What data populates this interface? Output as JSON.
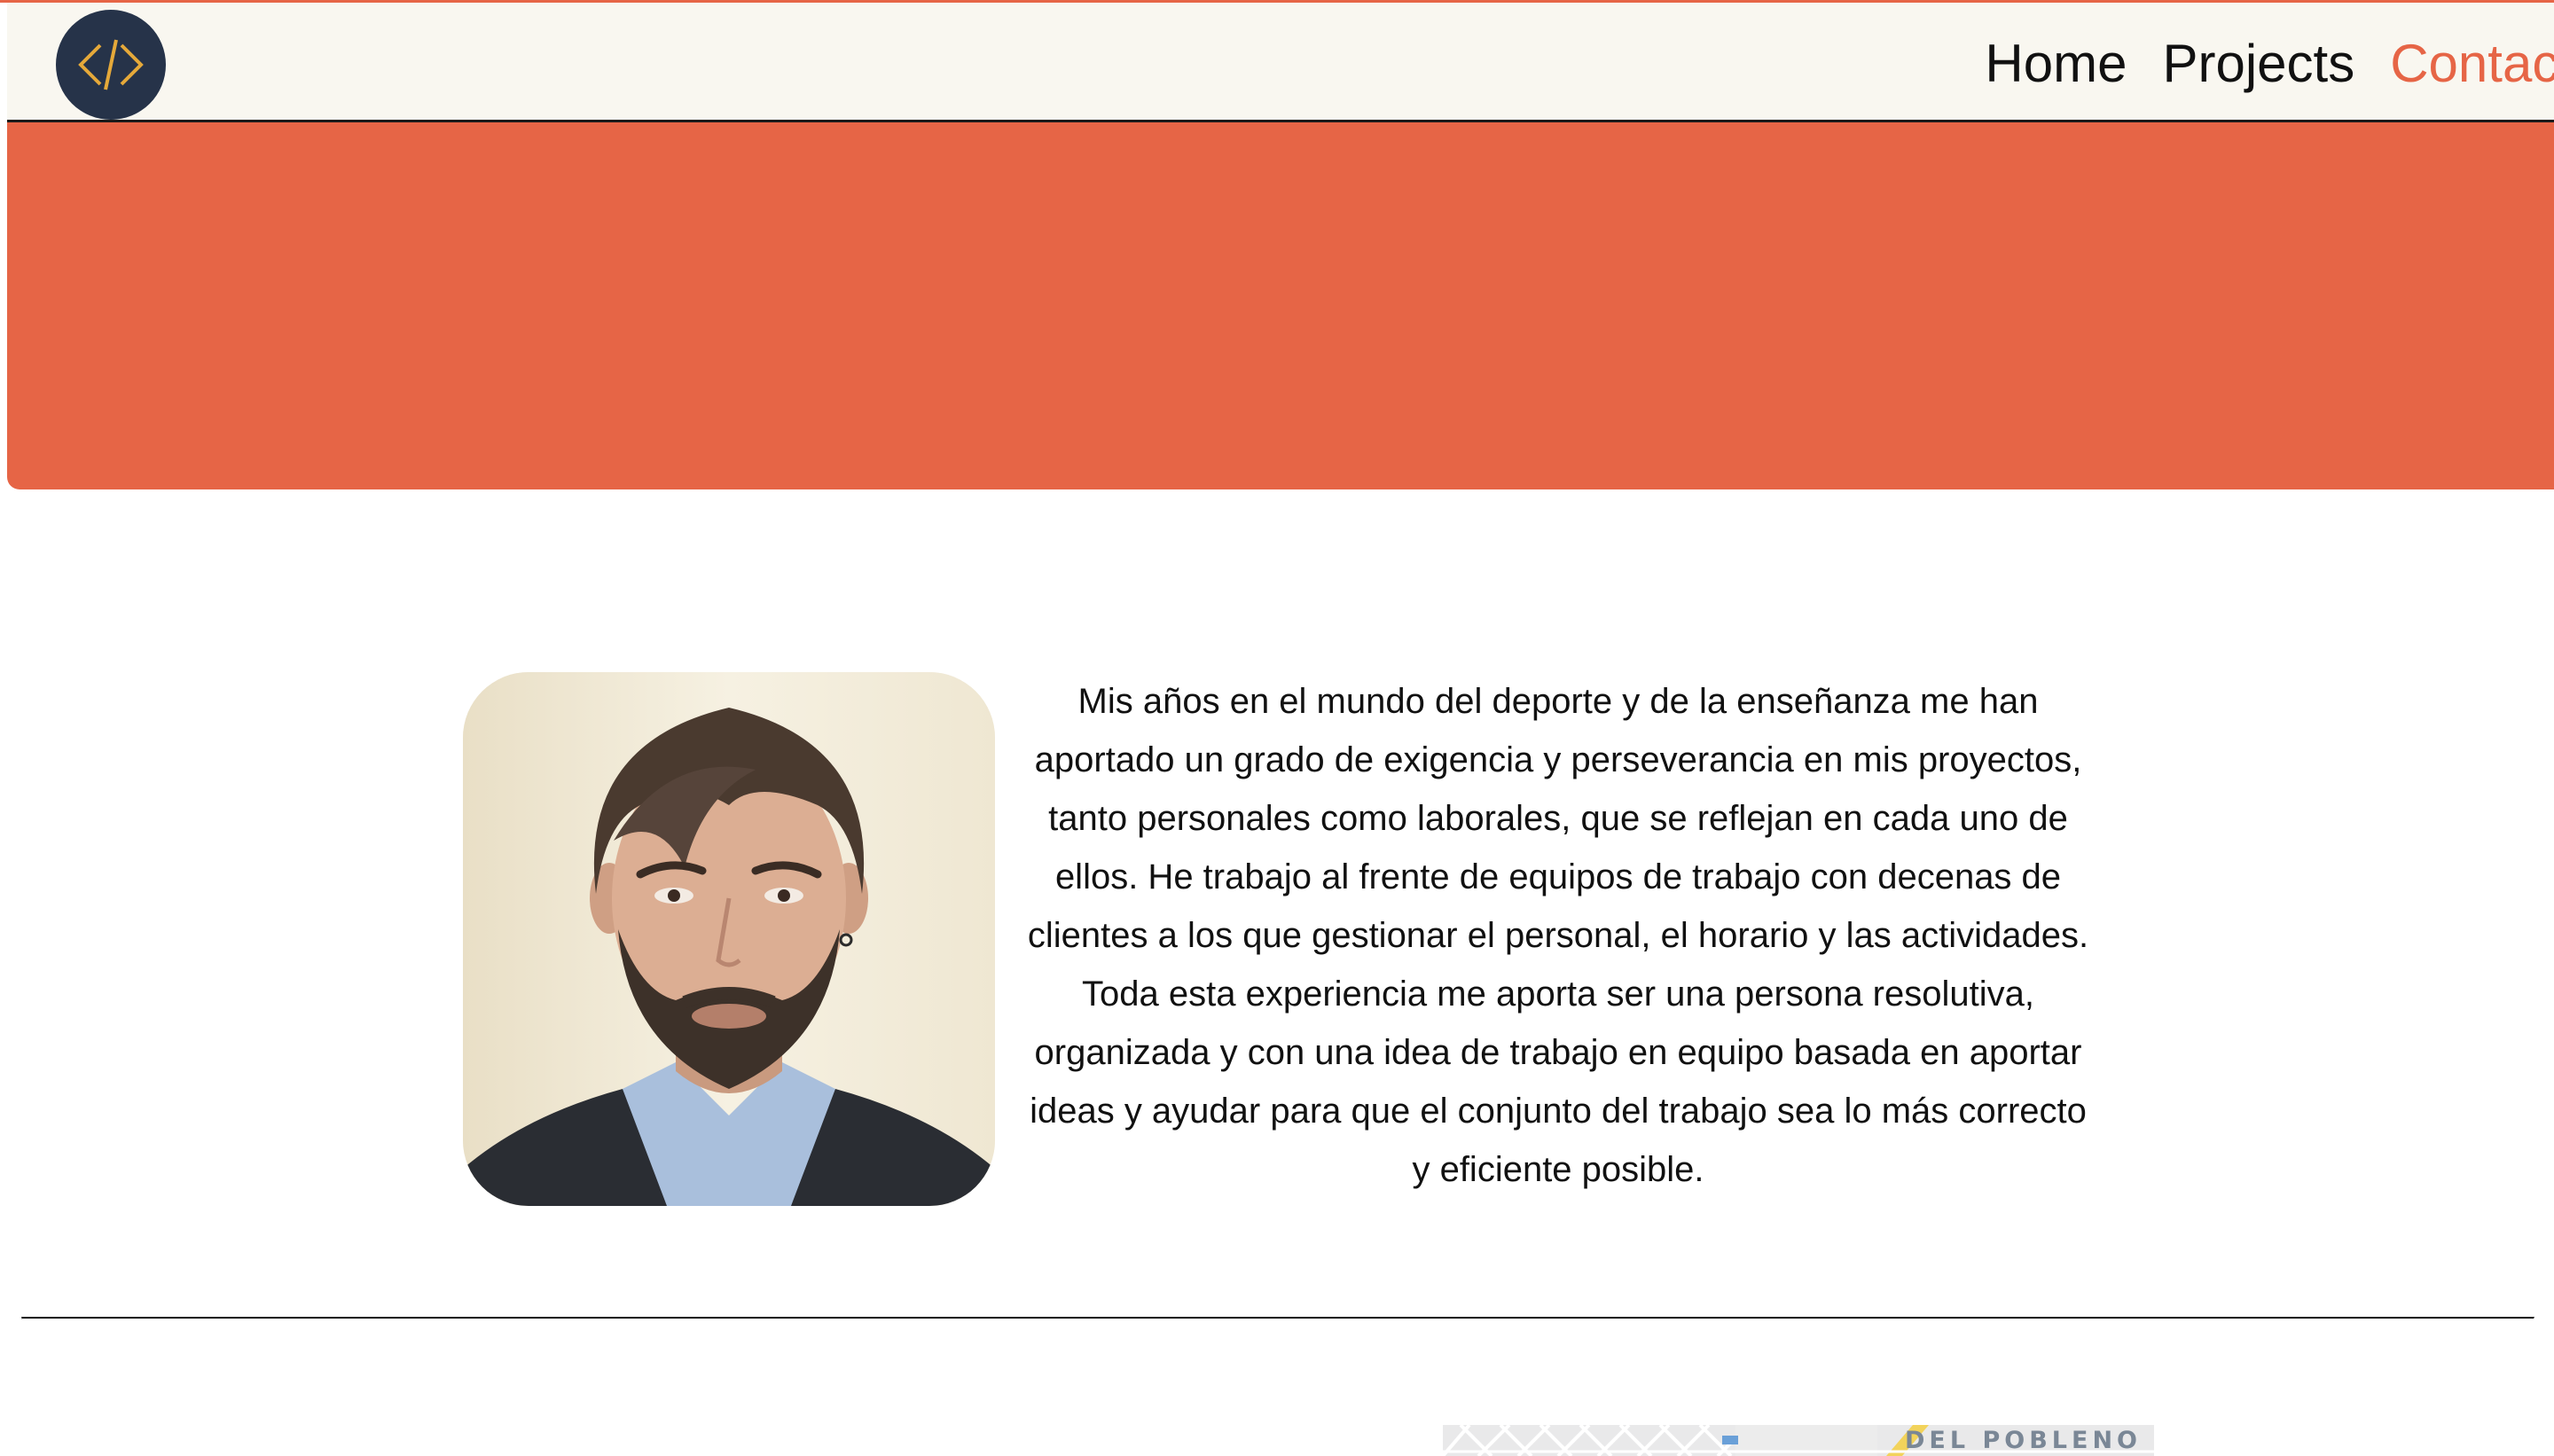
{
  "header": {
    "logo_icon": "code-brackets-icon",
    "nav": [
      {
        "label": "Home",
        "active": false
      },
      {
        "label": "Projects",
        "active": false
      },
      {
        "label": "Contact",
        "active": true
      }
    ]
  },
  "colors": {
    "accent": "#e66546",
    "navbar_bg": "#f9f7f0",
    "logo_bg": "#263349",
    "logo_glyph": "#e5a93a"
  },
  "about": {
    "photo": "profile-photo",
    "bio": "Mis años en el mundo del deporte y de la enseñanza me han aportado un grado de exigencia y perseverancia en mis proyectos, tanto personales como laborales, que se reflejan en cada uno de ellos. He trabajo al frente de equipos de trabajo con decenas de clientes a los que gestionar el personal, el horario y las actividades. Toda esta experiencia me aporta ser una persona resolutiva, organizada y con una idea de trabajo en equipo basada en aportar ideas y ayudar para que el conjunto del trabajo sea lo más correcto y eficiente posible."
  },
  "map": {
    "area_label": "DEL POBLENO"
  }
}
